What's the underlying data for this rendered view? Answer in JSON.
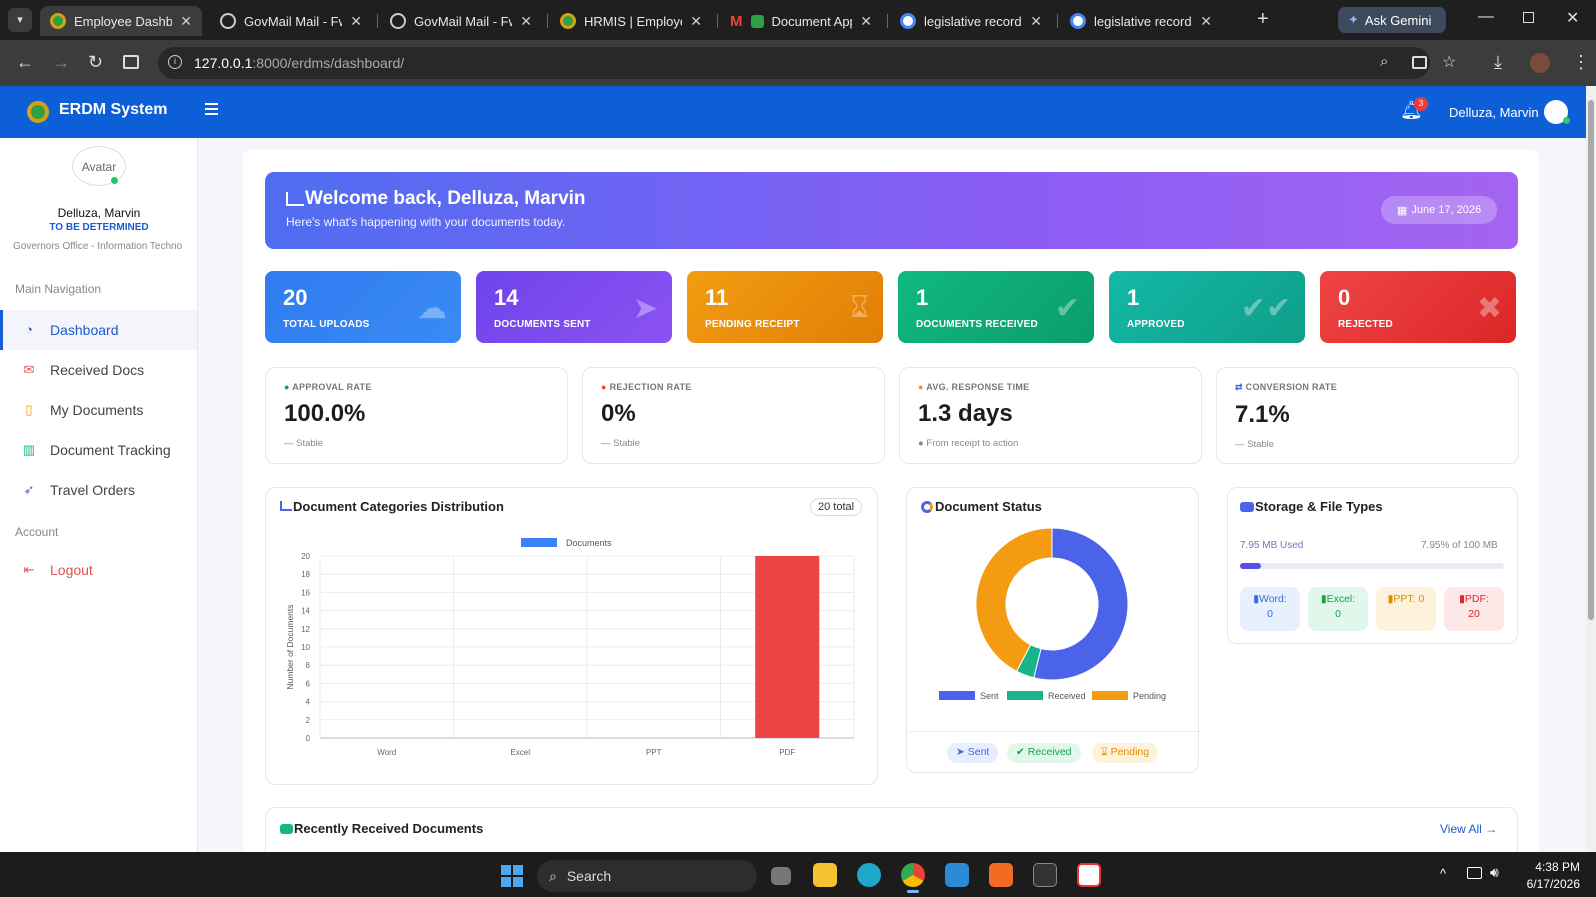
{
  "browser": {
    "tabs": [
      {
        "title": "Employee Dashboa",
        "active": true
      },
      {
        "title": "GovMail Mail - Fwd"
      },
      {
        "title": "GovMail Mail - Fwd"
      },
      {
        "title": "HRMIS | Employee"
      },
      {
        "title": "Document App"
      },
      {
        "title": "legislative record d"
      },
      {
        "title": "legislative record d"
      }
    ],
    "gemini": "Ask Gemini",
    "url_host": "127.0.0.1",
    "url_path": ":8000/erdms/dashboard/"
  },
  "header": {
    "brand": "ERDM System",
    "notif_count": "3",
    "user_name": "Delluza, Marvin"
  },
  "sidebar": {
    "avatar_alt": "Avatar",
    "name": "Delluza, Marvin",
    "role": "TO BE DETERMINED",
    "office": "Governors Office - Information Techno",
    "main_nav_title": "Main Navigation",
    "items": [
      "Dashboard",
      "Received Docs",
      "My Documents",
      "Document Tracking",
      "Travel Orders"
    ],
    "account_title": "Account",
    "logout": "Logout"
  },
  "welcome": {
    "title": "Welcome back, Delluza, Marvin",
    "subtitle": "Here's what's happening with your documents today.",
    "date": "June 17, 2026"
  },
  "stats": [
    {
      "value": "20",
      "label": "TOTAL UPLOADS",
      "color": "#2f7bf0"
    },
    {
      "value": "14",
      "label": "DOCUMENTS SENT",
      "color": "#7a45ee"
    },
    {
      "value": "11",
      "label": "PENDING RECEIPT",
      "color": "#f2920c"
    },
    {
      "value": "1",
      "label": "DOCUMENTS RECEIVED",
      "color": "#12b07a"
    },
    {
      "value": "1",
      "label": "APPROVED",
      "color": "#14b39a"
    },
    {
      "value": "0",
      "label": "REJECTED",
      "color": "#ef3a3a"
    }
  ],
  "metrics": [
    {
      "head": "APPROVAL RATE",
      "value": "100.0%",
      "sub": "— Stable"
    },
    {
      "head": "REJECTION RATE",
      "value": "0%",
      "sub": "— Stable"
    },
    {
      "head": "AVG. RESPONSE TIME",
      "value": "1.3 days",
      "sub": "From receipt to action"
    },
    {
      "head": "CONVERSION RATE",
      "value": "7.1%",
      "sub": "— Stable"
    }
  ],
  "categories_card": {
    "title": "Document Categories Distribution",
    "total_badge": "20 total"
  },
  "status_card": {
    "title": "Document Status",
    "legend": [
      "Sent",
      "Received",
      "Pending"
    ],
    "pills": [
      "Sent",
      "Received",
      "Pending"
    ]
  },
  "storage_card": {
    "title": "Storage & File Types",
    "used": "7.95 MB Used",
    "percent_text": "7.95% of 100 MB",
    "used_fraction": 0.0795,
    "types": [
      {
        "name": "Word:",
        "count": "0"
      },
      {
        "name": "Excel:",
        "count": "0"
      },
      {
        "name": "PPT: 0",
        "count": ""
      },
      {
        "name": "PDF:",
        "count": "20"
      }
    ]
  },
  "recent": {
    "title": "Recently Received Documents",
    "view_all": "View All →"
  },
  "taskbar": {
    "search": "Search",
    "time": "4:38 PM",
    "date": "6/17/2026"
  },
  "chart_data": [
    {
      "type": "bar",
      "categories": [
        "Word",
        "Excel",
        "PPT",
        "PDF"
      ],
      "series": [
        {
          "name": "Documents",
          "values": [
            0,
            0,
            0,
            20
          ],
          "color": "#ef4444"
        }
      ],
      "ylabel": "Number of Documents",
      "ylim": [
        0,
        20
      ],
      "yticks": [
        0,
        2,
        4,
        6,
        8,
        10,
        12,
        14,
        16,
        18,
        20
      ],
      "legend": "top"
    },
    {
      "type": "pie",
      "categories": [
        "Sent",
        "Received",
        "Pending"
      ],
      "values": [
        14,
        1,
        11
      ],
      "colors": [
        "#4a63e8",
        "#17b58a",
        "#f39c12"
      ],
      "legend": "bottom"
    }
  ]
}
